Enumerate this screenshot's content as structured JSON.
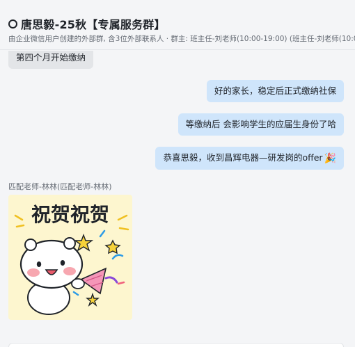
{
  "chat": {
    "title": "唐思毅-25秋【专属服务群】",
    "subtitle": "由企业微信用户创建的外部群, 含3位外部联系人 · 群主: 班主任-刘老师(10:00-19:00)  (班主任-刘老师(10:00"
  },
  "messages": [
    {
      "side": "left",
      "text": "第四个月开始缴纳"
    },
    {
      "side": "right",
      "text": "好的家长，稳定后正式缴纳社保"
    },
    {
      "side": "right",
      "text": "等缴纳后  会影响学生的应届生身份了哈"
    },
    {
      "side": "right",
      "text": "恭喜思毅，收到昌辉电器—研发岗的offer",
      "emoji": "🎉"
    }
  ],
  "sender_label": "匹配老师-林林(匹配老师-林林)",
  "sticker": {
    "text": "祝贺祝贺"
  },
  "colors": {
    "outgoing_bubble": "#cfe5fb",
    "incoming_bubble": "#e3e5e8",
    "background": "#f4f5f7"
  }
}
